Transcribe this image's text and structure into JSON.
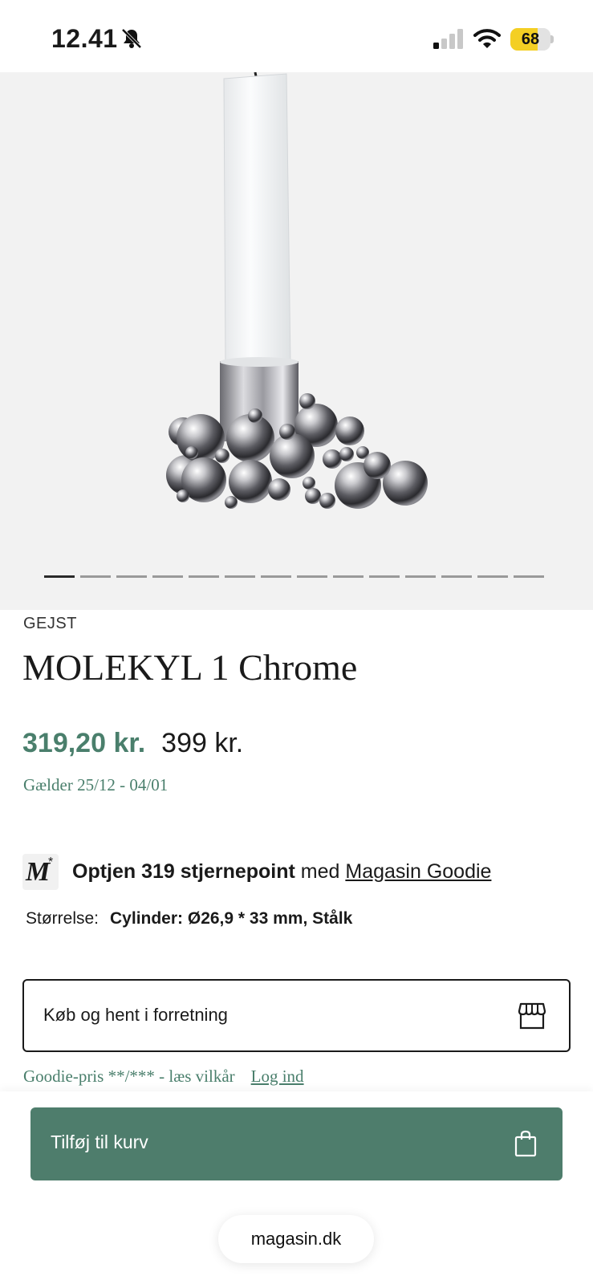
{
  "status_bar": {
    "time": "12.41",
    "battery": "68",
    "battery_level": 0.68,
    "icons": [
      "bell-slash-icon",
      "signal-icon",
      "wifi-icon",
      "battery-icon"
    ]
  },
  "gallery": {
    "image_count": 14,
    "active_index": 0
  },
  "product": {
    "brand": "GEJST",
    "name": "MOLEKYL 1 Chrome",
    "price_sale": "319,20 kr.",
    "price_original": "399 kr.",
    "valid_period": "Gælder 25/12 - 04/01"
  },
  "goodie": {
    "badge": "M",
    "badge_star": "*",
    "earn_bold": "Optjen 319 stjernepoint",
    "earn_mid": " med ",
    "program_link": "Magasin Goodie"
  },
  "size": {
    "label": "Størrelse:",
    "value": "Cylinder: Ø26,9 * 33 mm, Stålk"
  },
  "store_pickup": {
    "label": "Køb og hent i forretning",
    "icon": "store-icon"
  },
  "terms": {
    "text": "Goodie-pris **/*** - læs vilkår",
    "login": "Log ind"
  },
  "cart": {
    "label": "Tilføj til kurv",
    "icon": "shopping-bag-icon"
  },
  "browser": {
    "url": "magasin.dk"
  },
  "colors": {
    "accent_green": "#4e7d6c",
    "sale_green": "#4a7f6c",
    "battery_yellow": "#f4cf23"
  }
}
